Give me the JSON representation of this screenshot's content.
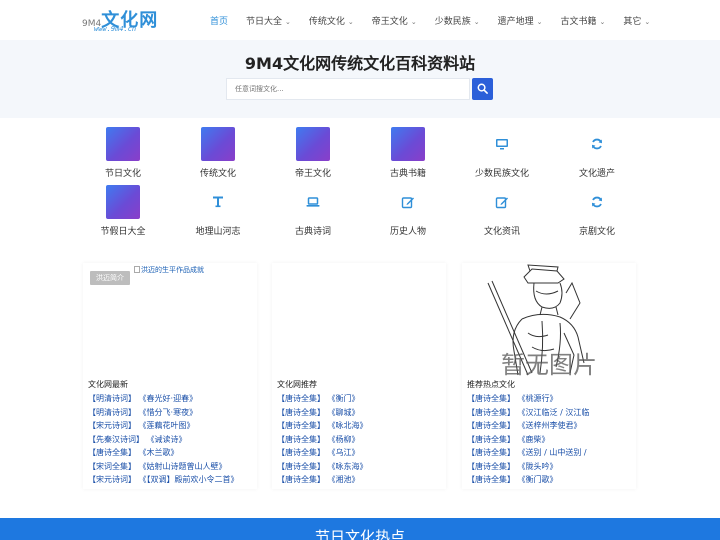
{
  "logo": {
    "prefix": "9M4",
    "text": "文化网",
    "sub": "www.9m4.cn"
  },
  "nav": [
    {
      "label": "首页",
      "active": true,
      "dropdown": false
    },
    {
      "label": "节日大全",
      "active": false,
      "dropdown": true
    },
    {
      "label": "传统文化",
      "active": false,
      "dropdown": true
    },
    {
      "label": "帝王文化",
      "active": false,
      "dropdown": true
    },
    {
      "label": "少数民族",
      "active": false,
      "dropdown": true
    },
    {
      "label": "遗产地理",
      "active": false,
      "dropdown": true
    },
    {
      "label": "古文书籍",
      "active": false,
      "dropdown": true
    },
    {
      "label": "其它",
      "active": false,
      "dropdown": true
    }
  ],
  "hero": {
    "title": "9M4文化网传统文化百科资料站",
    "search_placeholder": "任意词搜文化..."
  },
  "categories": [
    {
      "label": "节日文化",
      "icon": "gradient-tile"
    },
    {
      "label": "传统文化",
      "icon": "gradient-tile"
    },
    {
      "label": "帝王文化",
      "icon": "gradient-tile"
    },
    {
      "label": "古典书籍",
      "icon": "gradient-tile"
    },
    {
      "label": "少数民族文化",
      "icon": "monitor-icon"
    },
    {
      "label": "文化遗产",
      "icon": "refresh-icon"
    },
    {
      "label": "节假日大全",
      "icon": "gradient-tile"
    },
    {
      "label": "地理山河志",
      "icon": "text-icon"
    },
    {
      "label": "古典诗词",
      "icon": "laptop-icon"
    },
    {
      "label": "历史人物",
      "icon": "edit-icon"
    },
    {
      "label": "文化资讯",
      "icon": "edit-icon"
    },
    {
      "label": "京剧文化",
      "icon": "refresh-icon"
    }
  ],
  "cards": [
    {
      "badge": "洪迈简介",
      "image_alt": "洪迈的生平作品成就",
      "title": "文化网最新",
      "rows": [
        "【明清诗词】 《春光好·迎春》",
        "【明清诗词】 《惜分飞·寒夜》",
        "【宋元诗词】 《莲藕花叶图》",
        "【先秦汉诗词】 《诫读诗》",
        "【唐诗全集】 《木兰歌》",
        "【宋词全集】 《姑射山诗题曾山人壁》",
        "【宋元诗词】 《【双调】殿前欢小令二首》"
      ]
    },
    {
      "title": "文化网推荐",
      "rows": [
        "【唐诗全集】 《衡门》",
        "【唐诗全集】 《聊城》",
        "【唐诗全集】 《咏北海》",
        "【唐诗全集】 《杨柳》",
        "【唐诗全集】 《乌江》",
        "【唐诗全集】 《咏东海》",
        "【唐诗全集】 《湘池》"
      ]
    },
    {
      "image_text": "暂无图片",
      "title": "推荐热点文化",
      "rows": [
        "【唐诗全集】 《桃源行》",
        "【唐诗全集】 《汉江临泛 / 汉江临",
        "【唐诗全集】 《送梓州李使君》",
        "【唐诗全集】 《鹿柴》",
        "【唐诗全集】 《送别 / 山中送别 /",
        "【唐诗全集】 《陇头吟》",
        "【唐诗全集】 《衡门歌》"
      ]
    }
  ],
  "band": {
    "title": "节日文化热点"
  },
  "colors": {
    "accent": "#2f8fd8",
    "button": "#2b5fd9",
    "band": "#1e78e0",
    "link": "#1a4fa8"
  }
}
